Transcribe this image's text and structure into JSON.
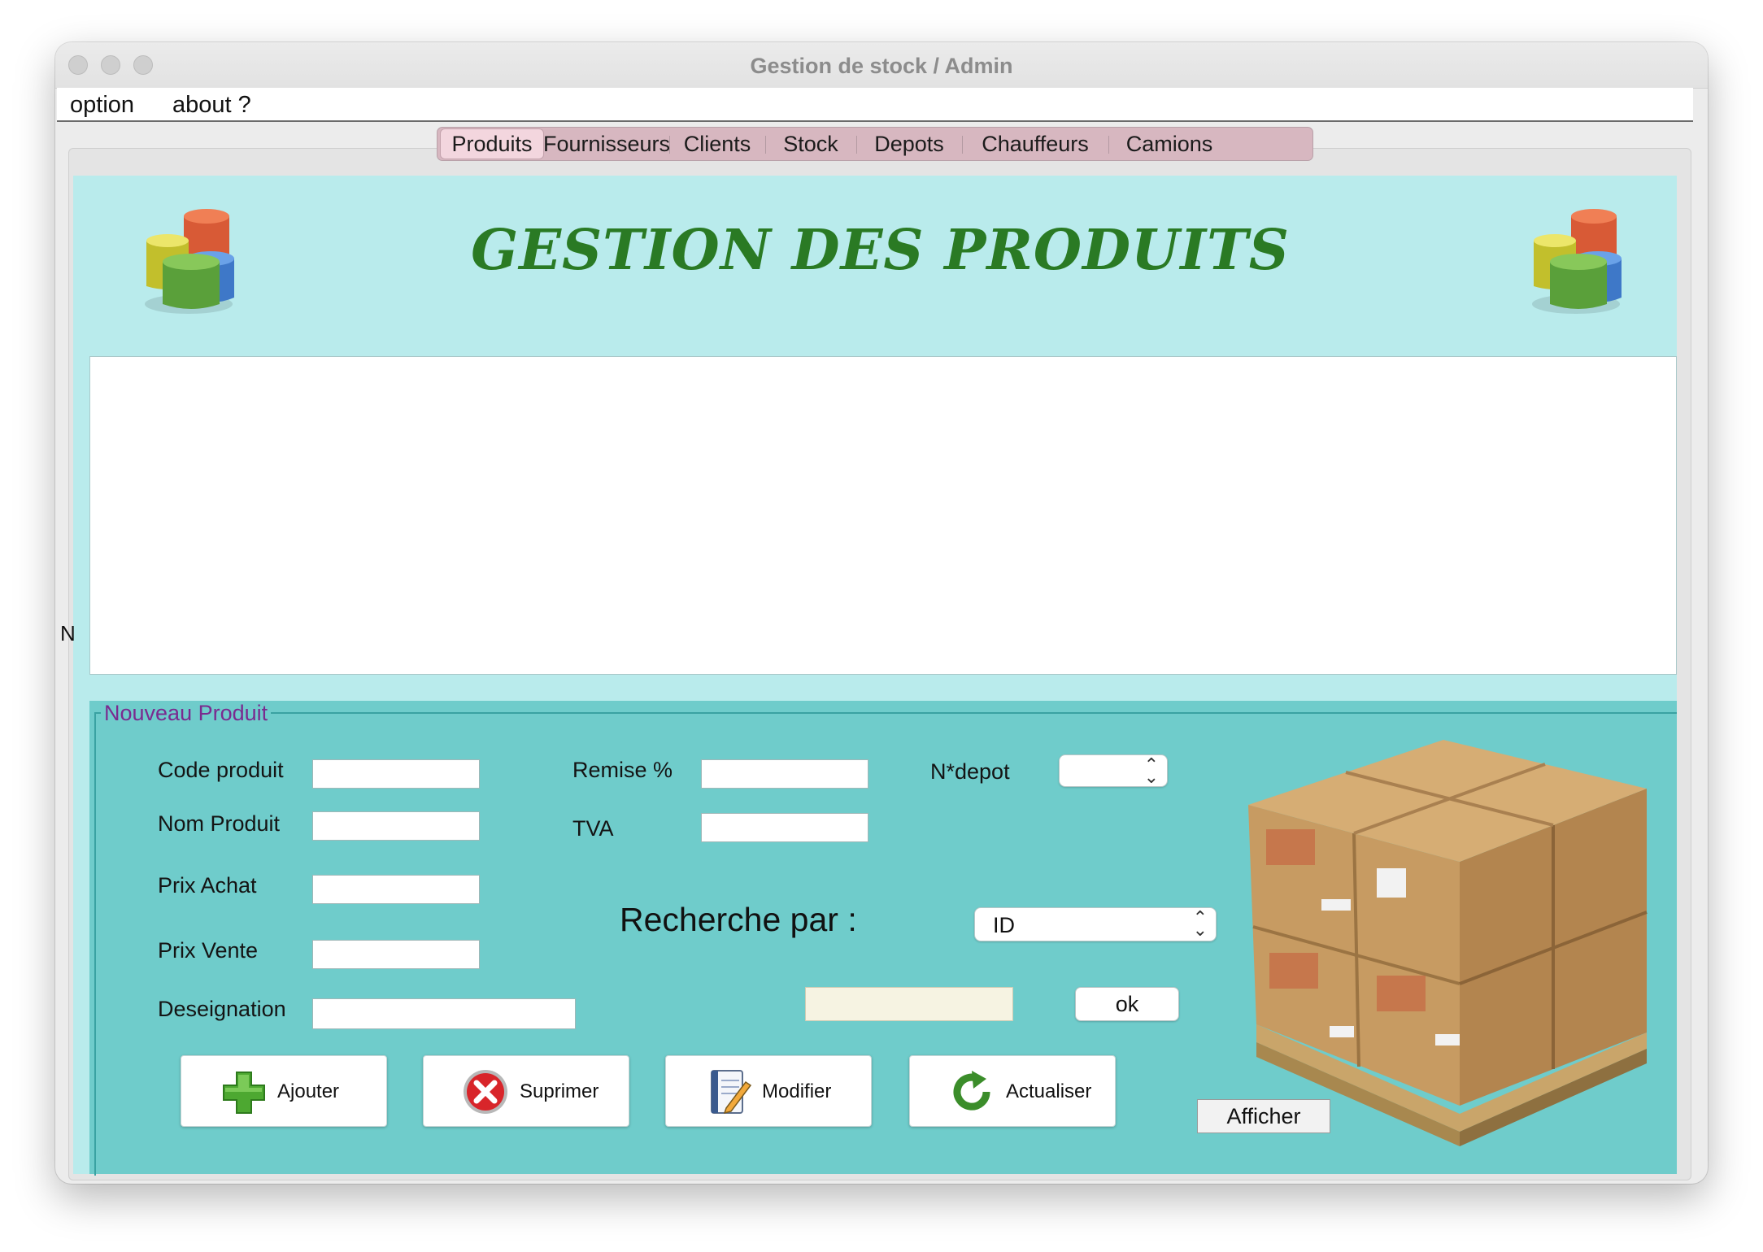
{
  "window": {
    "title": "Gestion de stock / Admin"
  },
  "menu": [
    {
      "label": "option"
    },
    {
      "label": "about ?"
    }
  ],
  "tabs": [
    {
      "label": "Produits",
      "active": true
    },
    {
      "label": "Fournisseurs"
    },
    {
      "label": "Clients"
    },
    {
      "label": "Stock"
    },
    {
      "label": "Depots"
    },
    {
      "label": "Chauffeurs"
    },
    {
      "label": "Camions"
    }
  ],
  "header": {
    "title": "GESTION DES PRODUITS"
  },
  "stray_label": "N",
  "form": {
    "legend": "Nouveau Produit",
    "code_label": "Code produit",
    "nom_label": "Nom Produit",
    "prix_achat_label": "Prix Achat",
    "prix_vente_label": "Prix Vente",
    "designation_label": "Deseignation",
    "remise_label": "Remise %",
    "tva_label": "TVA",
    "depot_label": "N*depot",
    "depot_value": "",
    "recherche_label": "Recherche par :",
    "recherche_value": "ID",
    "search_value": "",
    "ok_label": "ok"
  },
  "buttons": {
    "ajouter": "Ajouter",
    "suprimer": "Suprimer",
    "modifier": "Modifier",
    "actualiser": "Actualiser",
    "afficher": "Afficher"
  },
  "colors": {
    "header_bg": "#b9ebec",
    "form_bg": "#6fcccb",
    "title_green": "#2a7a24",
    "legend_purple": "#7a2b8f",
    "tab_bar": "#d7b7c0"
  },
  "icons": {
    "logo": "pie-chart-icon",
    "ajouter": "green-plus-icon",
    "suprimer": "red-x-icon",
    "modifier": "notepad-pencil-icon",
    "actualiser": "green-refresh-icon",
    "illustration": "cardboard-boxes-pallet"
  }
}
